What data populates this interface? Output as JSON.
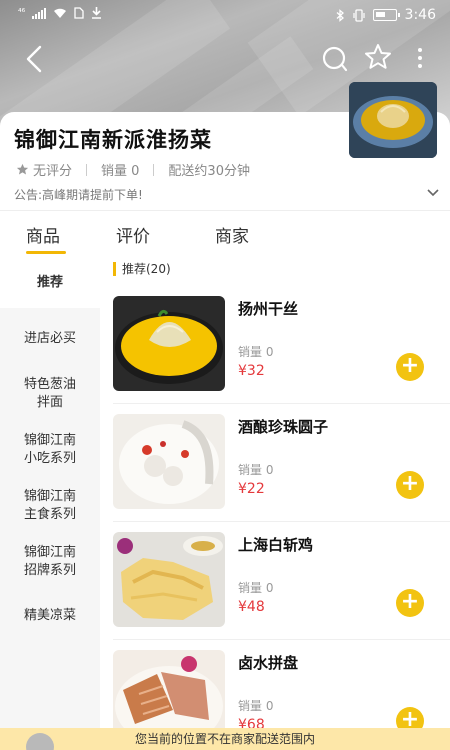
{
  "status_bar": {
    "left_text": "⁴⁶",
    "time": "3:46"
  },
  "store": {
    "name": "锦御江南新派淮扬菜",
    "rating": "无评分",
    "sales": "销量 0",
    "delivery": "配送约30分钟",
    "notice": "公告:高峰期请提前下单!"
  },
  "tabs": [
    "商品",
    "评价",
    "商家"
  ],
  "categories": [
    "推荐",
    "进店必买",
    "特色葱油\n拌面",
    "锦御江南\n小吃系列",
    "锦御江南\n主食系列",
    "锦御江南\n招牌系列",
    "精美凉菜"
  ],
  "section_title": "推荐(20)",
  "items": [
    {
      "name": "扬州干丝",
      "sales": "销量 0",
      "price": "¥32"
    },
    {
      "name": "酒酿珍珠圆子",
      "sales": "销量 0",
      "price": "¥22"
    },
    {
      "name": "上海白斩鸡",
      "sales": "销量 0",
      "price": "¥48"
    },
    {
      "name": "卤水拼盘",
      "sales": "销量 0",
      "price": "¥68"
    }
  ],
  "add_button_label": "+",
  "bottom_notice": "您当前的位置不在商家配送范围内",
  "icons": {
    "back": "chevron-left-icon",
    "search": "chat-bubble-icon",
    "favorite": "star-outline-icon",
    "more": "more-vertical-icon",
    "rating_star": "star-icon",
    "notice_toggle": "chevron-down-icon"
  },
  "colors": {
    "accent": "#f2c311",
    "price": "#e4393c",
    "bottom_bar": "#fde7a8"
  }
}
